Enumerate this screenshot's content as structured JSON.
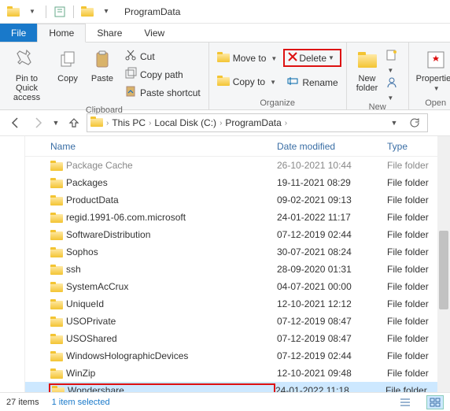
{
  "titlebar": {
    "title": "ProgramData"
  },
  "tabs": {
    "file": "File",
    "home": "Home",
    "share": "Share",
    "view": "View"
  },
  "ribbon": {
    "clipboard": {
      "label": "Clipboard",
      "pin": "Pin to Quick\naccess",
      "copy": "Copy",
      "paste": "Paste",
      "cut": "Cut",
      "copypath": "Copy path",
      "pasteshortcut": "Paste shortcut"
    },
    "organize": {
      "label": "Organize",
      "moveto": "Move to",
      "copyto": "Copy to",
      "delete": "Delete",
      "rename": "Rename"
    },
    "new": {
      "label": "New",
      "newfolder": "New\nfolder"
    },
    "open": {
      "label": "Open",
      "properties": "Properties"
    }
  },
  "address": {
    "crumbs": [
      "This PC",
      "Local Disk (C:)",
      "ProgramData"
    ]
  },
  "columns": {
    "name": "Name",
    "date": "Date modified",
    "type": "Type"
  },
  "rows": [
    {
      "name": "Package Cache",
      "date": "26-10-2021 10:44",
      "type": "File folder",
      "fade": true
    },
    {
      "name": "Packages",
      "date": "19-11-2021 08:29",
      "type": "File folder"
    },
    {
      "name": "ProductData",
      "date": "09-02-2021 09:13",
      "type": "File folder"
    },
    {
      "name": "regid.1991-06.com.microsoft",
      "date": "24-01-2022 11:17",
      "type": "File folder"
    },
    {
      "name": "SoftwareDistribution",
      "date": "07-12-2019 02:44",
      "type": "File folder"
    },
    {
      "name": "Sophos",
      "date": "30-07-2021 08:24",
      "type": "File folder"
    },
    {
      "name": "ssh",
      "date": "28-09-2020 01:31",
      "type": "File folder"
    },
    {
      "name": "SystemAcCrux",
      "date": "04-07-2021 00:00",
      "type": "File folder"
    },
    {
      "name": "UniqueId",
      "date": "12-10-2021 12:12",
      "type": "File folder"
    },
    {
      "name": "USOPrivate",
      "date": "07-12-2019 08:47",
      "type": "File folder"
    },
    {
      "name": "USOShared",
      "date": "07-12-2019 08:47",
      "type": "File folder"
    },
    {
      "name": "WindowsHolographicDevices",
      "date": "07-12-2019 02:44",
      "type": "File folder"
    },
    {
      "name": "WinZip",
      "date": "12-10-2021 09:48",
      "type": "File folder"
    },
    {
      "name": "Wondershare",
      "date": "24-01-2022 11:18",
      "type": "File folder",
      "sel": true,
      "boxed": true
    }
  ],
  "status": {
    "count": "27 items",
    "selected": "1 item selected"
  }
}
